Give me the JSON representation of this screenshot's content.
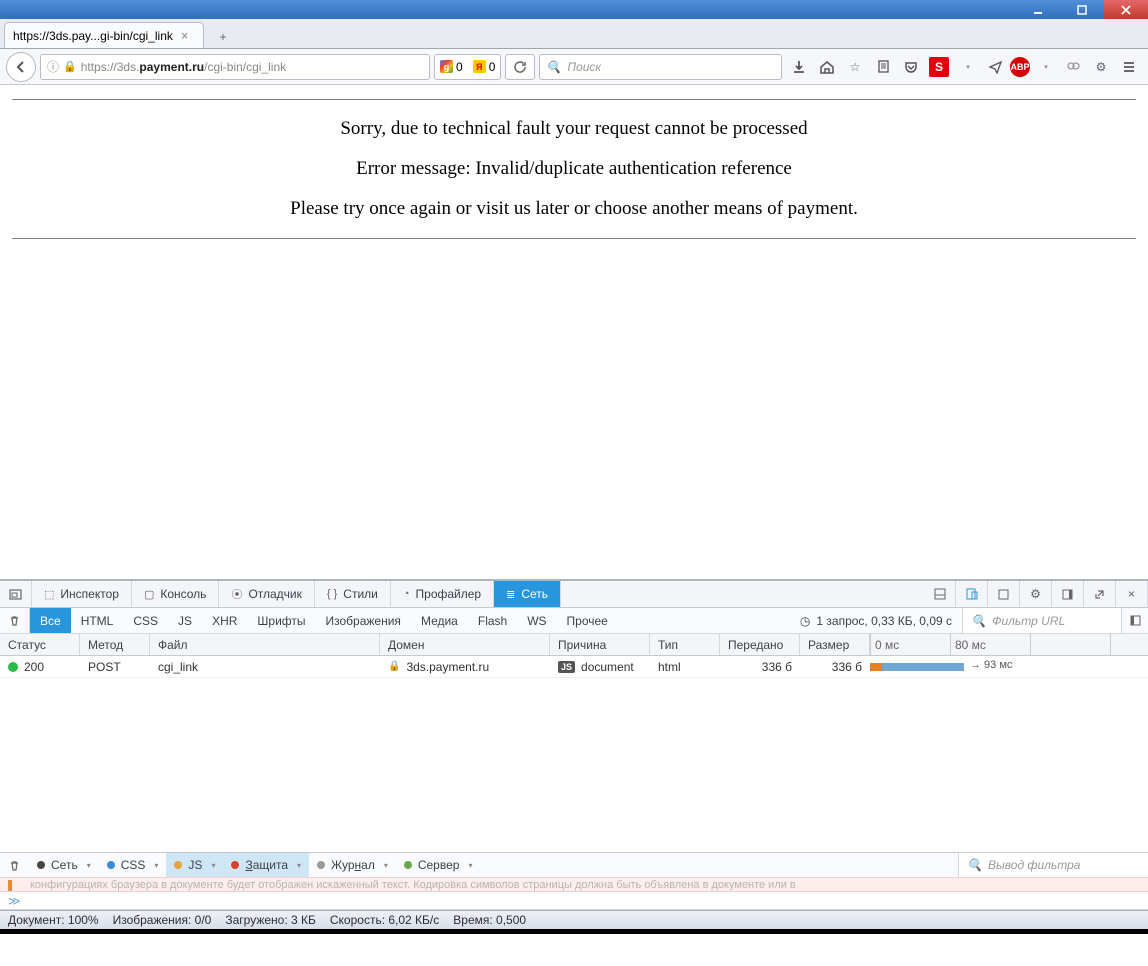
{
  "window": {
    "title": ""
  },
  "tab": {
    "title": "https://3ds.pay...gi-bin/cgi_link"
  },
  "nav": {
    "url_prefix": "https://3ds.",
    "url_host": "payment.ru",
    "url_path": "/cgi-bin/cgi_link",
    "indicator_g": "0",
    "indicator_y": "0",
    "search_placeholder": "Поиск"
  },
  "page": {
    "line1": "Sorry, due to technical fault your request cannot be processed",
    "line2": "Error message: Invalid/duplicate authentication reference",
    "line3": "Please try once again or visit us later or choose another means of payment."
  },
  "devtools": {
    "tabs": {
      "inspector": "Инспектор",
      "console": "Консоль",
      "debugger": "Отладчик",
      "styles": "Стили",
      "profiler": "Профайлер",
      "network": "Сеть"
    },
    "filters": {
      "all": "Все",
      "html": "HTML",
      "css": "CSS",
      "js": "JS",
      "xhr": "XHR",
      "fonts": "Шрифты",
      "images": "Изображения",
      "media": "Медиа",
      "flash": "Flash",
      "ws": "WS",
      "other": "Прочее"
    },
    "summary": "1 запрос, 0,33 КБ, 0,09 с",
    "filter_url_placeholder": "Фильтр URL",
    "columns": {
      "status": "Статус",
      "method": "Метод",
      "file": "Файл",
      "domain": "Домен",
      "cause": "Причина",
      "type": "Тип",
      "transferred": "Передано",
      "size": "Размер",
      "t0": "0 мс",
      "t1": "80 мс"
    },
    "rows": [
      {
        "status": "200",
        "method": "POST",
        "file": "cgi_link",
        "domain": "3ds.payment.ru",
        "cause_badge": "JS",
        "cause": "document",
        "type": "html",
        "transferred": "336 б",
        "size": "336 б",
        "timing_label": "→ 93 мс"
      }
    ],
    "console_tabs": {
      "network": "Сеть",
      "css": "CSS",
      "js": "JS",
      "security": "Защита",
      "log": "Журнал",
      "server": "Сервер"
    },
    "console_filter_placeholder": "Вывод фильтра",
    "warning_text": "конфигурациях браузера в документе будет отображен искаженный текст. Кодировка символов страницы должна быть объявлена в документе или в",
    "prompt": "≫"
  },
  "statusbar": {
    "doc": "Документ: 100%",
    "images": "Изображения: 0/0",
    "loaded": "Загружено: 3 КБ",
    "speed": "Скорость: 6,02 КБ/с",
    "time": "Время: 0,500"
  }
}
